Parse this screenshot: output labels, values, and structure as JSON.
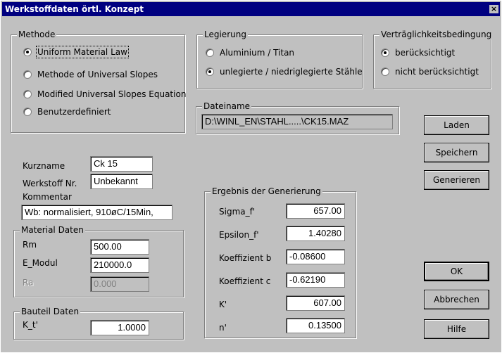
{
  "window": {
    "title": "Werkstoffdaten örtl. Konzept",
    "close_glyph": "×"
  },
  "methode": {
    "legend": "Methode",
    "options": [
      "Uniform Material Law",
      "Methode of Universal Slopes",
      "Modified Universal Slopes Equation",
      "Benutzerdefiniert"
    ],
    "selected_index": 0
  },
  "legierung": {
    "legend": "Legierung",
    "options": [
      "Aluminium / Titan",
      "unlegierte / niedriglegierte Stähle"
    ],
    "selected_index": 1
  },
  "vertraeglichkeit": {
    "legend": "Verträglichkeitsbedingung",
    "options": [
      "berücksichtigt",
      "nicht berücksichtigt"
    ],
    "selected_index": 0
  },
  "dateiname": {
    "legend": "Dateiname",
    "value": "D:\\WINL_EN\\STAHL.....\\CK15.MAZ"
  },
  "buttons": {
    "laden": "Laden",
    "speichern": "Speichern",
    "generieren": "Generieren",
    "ok": "OK",
    "abbrechen": "Abbrechen",
    "hilfe": "Hilfe"
  },
  "stamm": {
    "kurzname_label": "Kurzname",
    "kurzname_value": "Ck 15",
    "werkstoff_label": "Werkstoff Nr.",
    "werkstoff_value": "Unbekannt",
    "kommentar_label": "Kommentar",
    "kommentar_value": "Wb: normalisiert, 910øC/15Min,"
  },
  "material": {
    "legend": "Material Daten",
    "rm_label": "Rm",
    "rm_value": "500.00",
    "emodul_label": "E_Modul",
    "emodul_value": "210000.0",
    "ra_label": "Ra",
    "ra_value": "0.000"
  },
  "bauteil": {
    "legend": "Bauteil Daten",
    "kt_label": "K_t'",
    "kt_value": "1.0000"
  },
  "ergebnis": {
    "legend": "Ergebnis der Generierung",
    "rows": [
      {
        "label": "Sigma_f'",
        "value": "657.00"
      },
      {
        "label": "Epsilon_f'",
        "value": "1.40280"
      },
      {
        "label": "Koeffizient b",
        "value": "-0.08600"
      },
      {
        "label": "Koeffizient c",
        "value": "-0.62190"
      },
      {
        "label": "K'",
        "value": "607.00"
      },
      {
        "label": "n'",
        "value": "0.13500"
      }
    ]
  }
}
